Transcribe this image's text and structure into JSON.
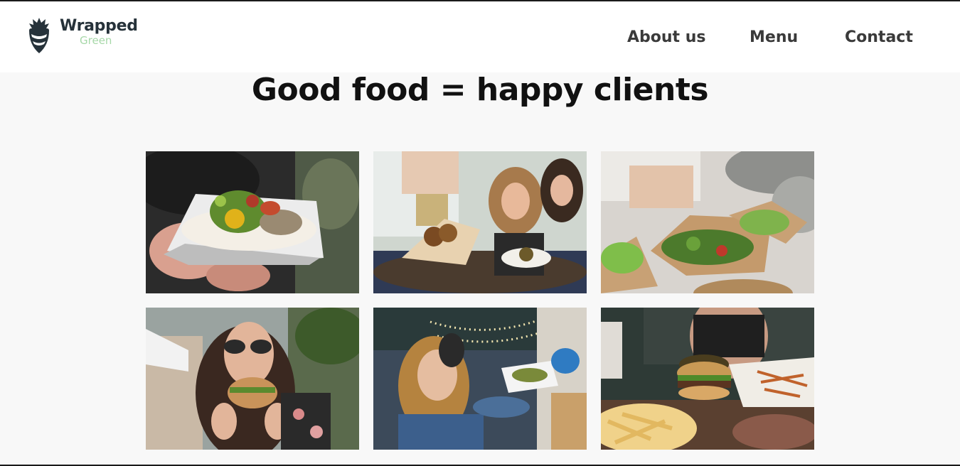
{
  "brand": {
    "name_line1": "Wrapped",
    "name_line2": "Green",
    "logo_icon": "radish-icon",
    "colors": {
      "dark": "#26323a",
      "accent": "#a6d8a8"
    }
  },
  "nav": {
    "items": [
      {
        "label": "About us"
      },
      {
        "label": "Menu"
      },
      {
        "label": "Contact"
      }
    ]
  },
  "main": {
    "headline": "Good food = happy clients"
  },
  "gallery": {
    "photos": [
      {
        "name": "photo-hands-holding-wrap"
      },
      {
        "name": "photo-sauce-being-poured"
      },
      {
        "name": "photo-salads-being-prepared"
      },
      {
        "name": "photo-woman-eating-burger"
      },
      {
        "name": "photo-woman-receiving-food"
      },
      {
        "name": "photo-burger-and-fries"
      }
    ]
  }
}
